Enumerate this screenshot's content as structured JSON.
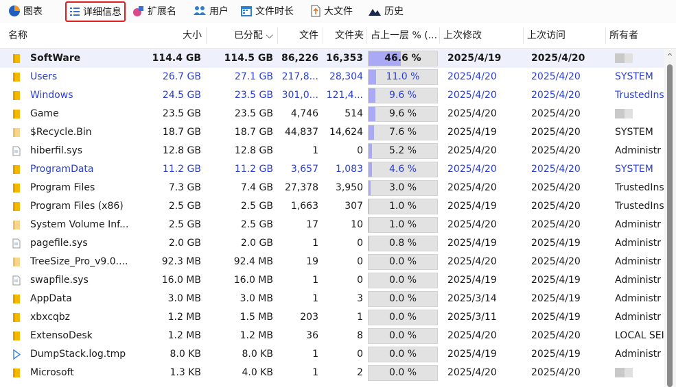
{
  "toolbar": {
    "items": [
      {
        "label": "图表",
        "icon": "pie-chart-icon"
      },
      {
        "label": "详细信息",
        "icon": "details-list-icon",
        "active": true
      },
      {
        "label": "扩展名",
        "icon": "extension-icon"
      },
      {
        "label": "用户",
        "icon": "users-icon"
      },
      {
        "label": "文件时长",
        "icon": "calendar-icon"
      },
      {
        "label": "大文件",
        "icon": "large-file-icon"
      },
      {
        "label": "历史",
        "icon": "history-icon"
      }
    ]
  },
  "columns": {
    "name": "名称",
    "size": "大小",
    "allocated": "已分配 ⌵",
    "files": "文件",
    "folders": "文件夹",
    "percent": "占上一层 % (...",
    "modified": "上次修改",
    "accessed": "上次访问",
    "owner": "所有者"
  },
  "rows": [
    {
      "name": "SoftWare",
      "type": "folder",
      "style": "bold",
      "size": "114.4 GB",
      "allocated": "114.5 GB",
      "files": "86,226",
      "folders": "16,353",
      "percent_label": "46.6 %",
      "percent": 46.6,
      "modified": "2025/4/19",
      "accessed": "2025/4/20",
      "owner": ""
    },
    {
      "name": "Users",
      "type": "folder",
      "style": "blue",
      "size": "26.7 GB",
      "allocated": "27.1 GB",
      "files": "217,8...",
      "folders": "28,304",
      "percent_label": "11.0 %",
      "percent": 11.0,
      "modified": "2025/4/20",
      "accessed": "2025/4/20",
      "owner": "SYSTEM"
    },
    {
      "name": "Windows",
      "type": "folder",
      "style": "blue",
      "size": "24.5 GB",
      "allocated": "23.5 GB",
      "files": "301,0...",
      "folders": "121,4...",
      "percent_label": "9.6 %",
      "percent": 9.6,
      "modified": "2025/4/20",
      "accessed": "2025/4/20",
      "owner": "TrustedIns"
    },
    {
      "name": "Game",
      "type": "folder",
      "style": "normal",
      "size": "23.5 GB",
      "allocated": "23.5 GB",
      "files": "4,746",
      "folders": "514",
      "percent_label": "9.6 %",
      "percent": 9.6,
      "modified": "2025/4/20",
      "accessed": "2025/4/20",
      "owner": ""
    },
    {
      "name": "$Recycle.Bin",
      "type": "folder-light",
      "style": "normal",
      "size": "18.7 GB",
      "allocated": "18.7 GB",
      "files": "44,837",
      "folders": "14,624",
      "percent_label": "7.6 %",
      "percent": 7.6,
      "modified": "2025/4/19",
      "accessed": "2025/4/20",
      "owner": "SYSTEM"
    },
    {
      "name": "hiberfil.sys",
      "type": "file",
      "style": "normal",
      "size": "12.8 GB",
      "allocated": "12.8 GB",
      "files": "1",
      "folders": "0",
      "percent_label": "5.2 %",
      "percent": 5.2,
      "modified": "2025/4/20",
      "accessed": "2025/4/20",
      "owner": "Administr"
    },
    {
      "name": "ProgramData",
      "type": "folder",
      "style": "blue",
      "size": "11.2 GB",
      "allocated": "11.2 GB",
      "files": "3,657",
      "folders": "1,083",
      "percent_label": "4.6 %",
      "percent": 4.6,
      "modified": "2025/4/20",
      "accessed": "2025/4/20",
      "owner": "SYSTEM"
    },
    {
      "name": "Program Files",
      "type": "folder",
      "style": "normal",
      "size": "7.3 GB",
      "allocated": "7.4 GB",
      "files": "27,378",
      "folders": "3,950",
      "percent_label": "3.0 %",
      "percent": 3.0,
      "modified": "2025/4/20",
      "accessed": "2025/4/20",
      "owner": "TrustedIns"
    },
    {
      "name": "Program Files (x86)",
      "type": "folder",
      "style": "normal",
      "size": "2.5 GB",
      "allocated": "2.5 GB",
      "files": "1,663",
      "folders": "307",
      "percent_label": "1.0 %",
      "percent": 1.0,
      "modified": "2025/4/19",
      "accessed": "2025/4/20",
      "owner": "TrustedIns"
    },
    {
      "name": "System Volume Inf...",
      "type": "folder-light",
      "style": "normal",
      "size": "2.5 GB",
      "allocated": "2.5 GB",
      "files": "17",
      "folders": "10",
      "percent_label": "1.0 %",
      "percent": 1.0,
      "modified": "2025/4/20",
      "accessed": "2025/4/20",
      "owner": "Administr"
    },
    {
      "name": "pagefile.sys",
      "type": "file",
      "style": "normal",
      "size": "2.0 GB",
      "allocated": "2.0 GB",
      "files": "1",
      "folders": "0",
      "percent_label": "0.8 %",
      "percent": 0.8,
      "modified": "2025/4/19",
      "accessed": "2025/4/19",
      "owner": "Administr"
    },
    {
      "name": "TreeSize_Pro_v9.0....",
      "type": "folder-light",
      "style": "normal",
      "size": "92.3 MB",
      "allocated": "92.4 MB",
      "files": "19",
      "folders": "0",
      "percent_label": "0.0 %",
      "percent": 0.0,
      "modified": "2025/4/20",
      "accessed": "2025/4/20",
      "owner": "Administr"
    },
    {
      "name": "swapfile.sys",
      "type": "file",
      "style": "normal",
      "size": "16.0 MB",
      "allocated": "16.0 MB",
      "files": "1",
      "folders": "0",
      "percent_label": "0.0 %",
      "percent": 0.0,
      "modified": "2025/4/19",
      "accessed": "2025/4/19",
      "owner": "Administr"
    },
    {
      "name": "AppData",
      "type": "folder",
      "style": "normal",
      "size": "3.0 MB",
      "allocated": "3.0 MB",
      "files": "1",
      "folders": "3",
      "percent_label": "0.0 %",
      "percent": 0.0,
      "modified": "2025/3/14",
      "accessed": "2025/4/19",
      "owner": "Administr"
    },
    {
      "name": "xbxcqbz",
      "type": "folder",
      "style": "normal",
      "size": "1.2 MB",
      "allocated": "1.5 MB",
      "files": "203",
      "folders": "1",
      "percent_label": "0.0 %",
      "percent": 0.0,
      "modified": "2025/3/11",
      "accessed": "2025/4/19",
      "owner": "Administr"
    },
    {
      "name": "ExtensoDesk",
      "type": "folder",
      "style": "normal",
      "size": "1.2 MB",
      "allocated": "1.2 MB",
      "files": "36",
      "folders": "8",
      "percent_label": "0.0 %",
      "percent": 0.0,
      "modified": "2025/4/20",
      "accessed": "2025/4/20",
      "owner": "LOCAL SEI"
    },
    {
      "name": "DumpStack.log.tmp",
      "type": "play",
      "style": "normal",
      "size": "8.0 KB",
      "allocated": "8.0 KB",
      "files": "1",
      "folders": "0",
      "percent_label": "0.0 %",
      "percent": 0.0,
      "modified": "2025/4/19",
      "accessed": "2025/4/19",
      "owner": "Administr"
    },
    {
      "name": "Microsoft",
      "type": "folder",
      "style": "normal",
      "size": "1.3 KB",
      "allocated": "4.0 KB",
      "files": "1",
      "folders": "2",
      "percent_label": "0.0 %",
      "percent": 0.0,
      "modified": "2025/4/20",
      "accessed": "2025/4/20",
      "owner": ""
    }
  ]
}
